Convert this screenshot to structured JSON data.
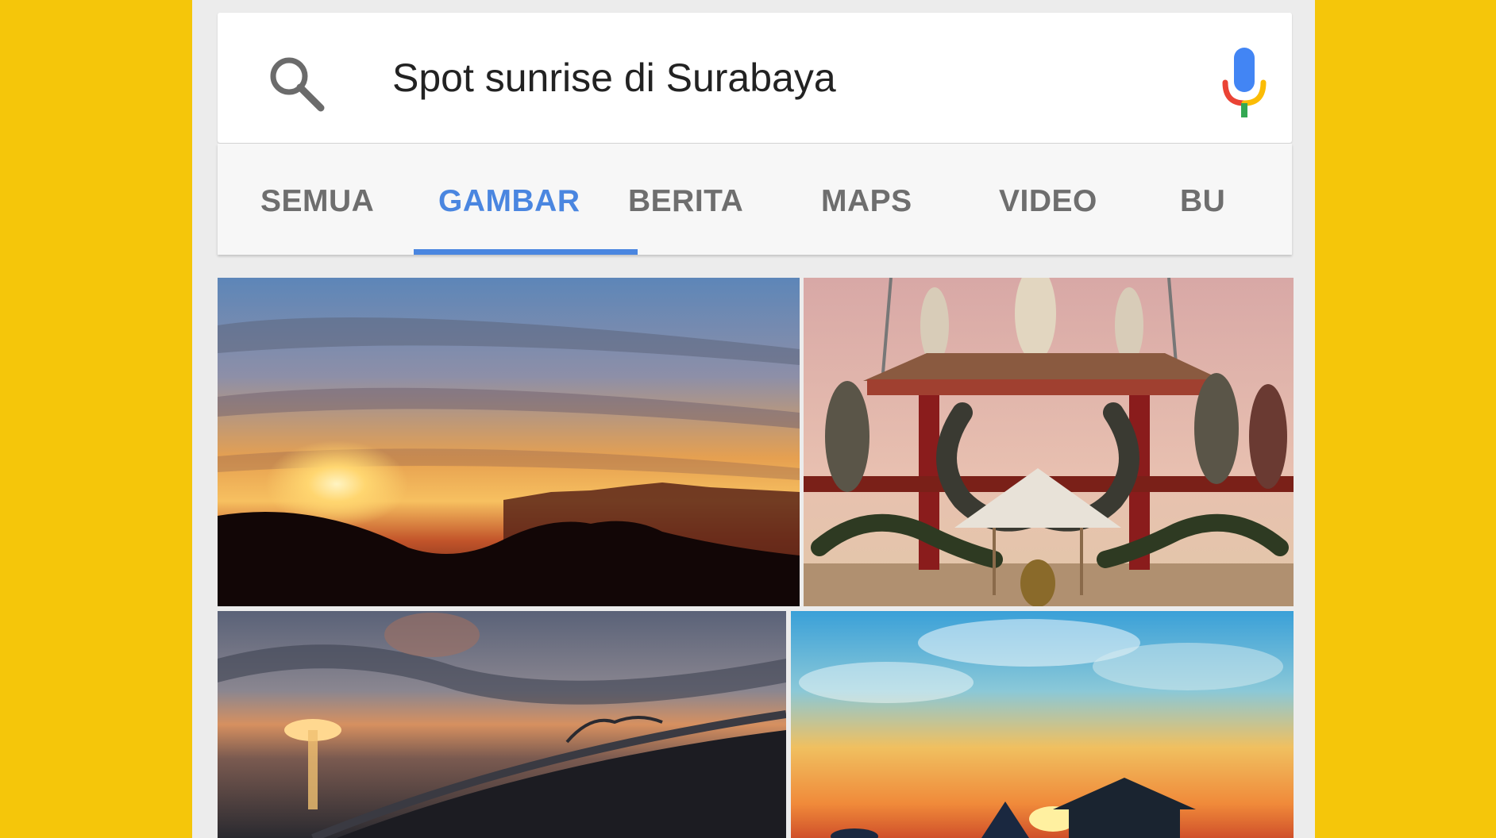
{
  "search": {
    "query": "Spot sunrise di Surabaya"
  },
  "tabs": [
    {
      "label": "SEMUA",
      "active": false
    },
    {
      "label": "GAMBAR",
      "active": true
    },
    {
      "label": "BERITA",
      "active": false
    },
    {
      "label": "MAPS",
      "active": false
    },
    {
      "label": "VIDEO",
      "active": false
    },
    {
      "label": "BU",
      "active": false
    }
  ],
  "colors": {
    "background": "#F5C60A",
    "active_tab": "#4a86e0",
    "inactive_tab": "#6e6e6e",
    "mic_blue": "#4285F4",
    "mic_red": "#EA4335",
    "mic_yellow": "#FBBC05",
    "mic_green": "#34A853"
  },
  "icons": {
    "search": "search-icon",
    "mic": "microphone-icon"
  },
  "images": [
    {
      "name": "sunset-mountain-image"
    },
    {
      "name": "temple-gate-image"
    },
    {
      "name": "sunset-bridge-image"
    },
    {
      "name": "beach-sunset-image"
    }
  ]
}
